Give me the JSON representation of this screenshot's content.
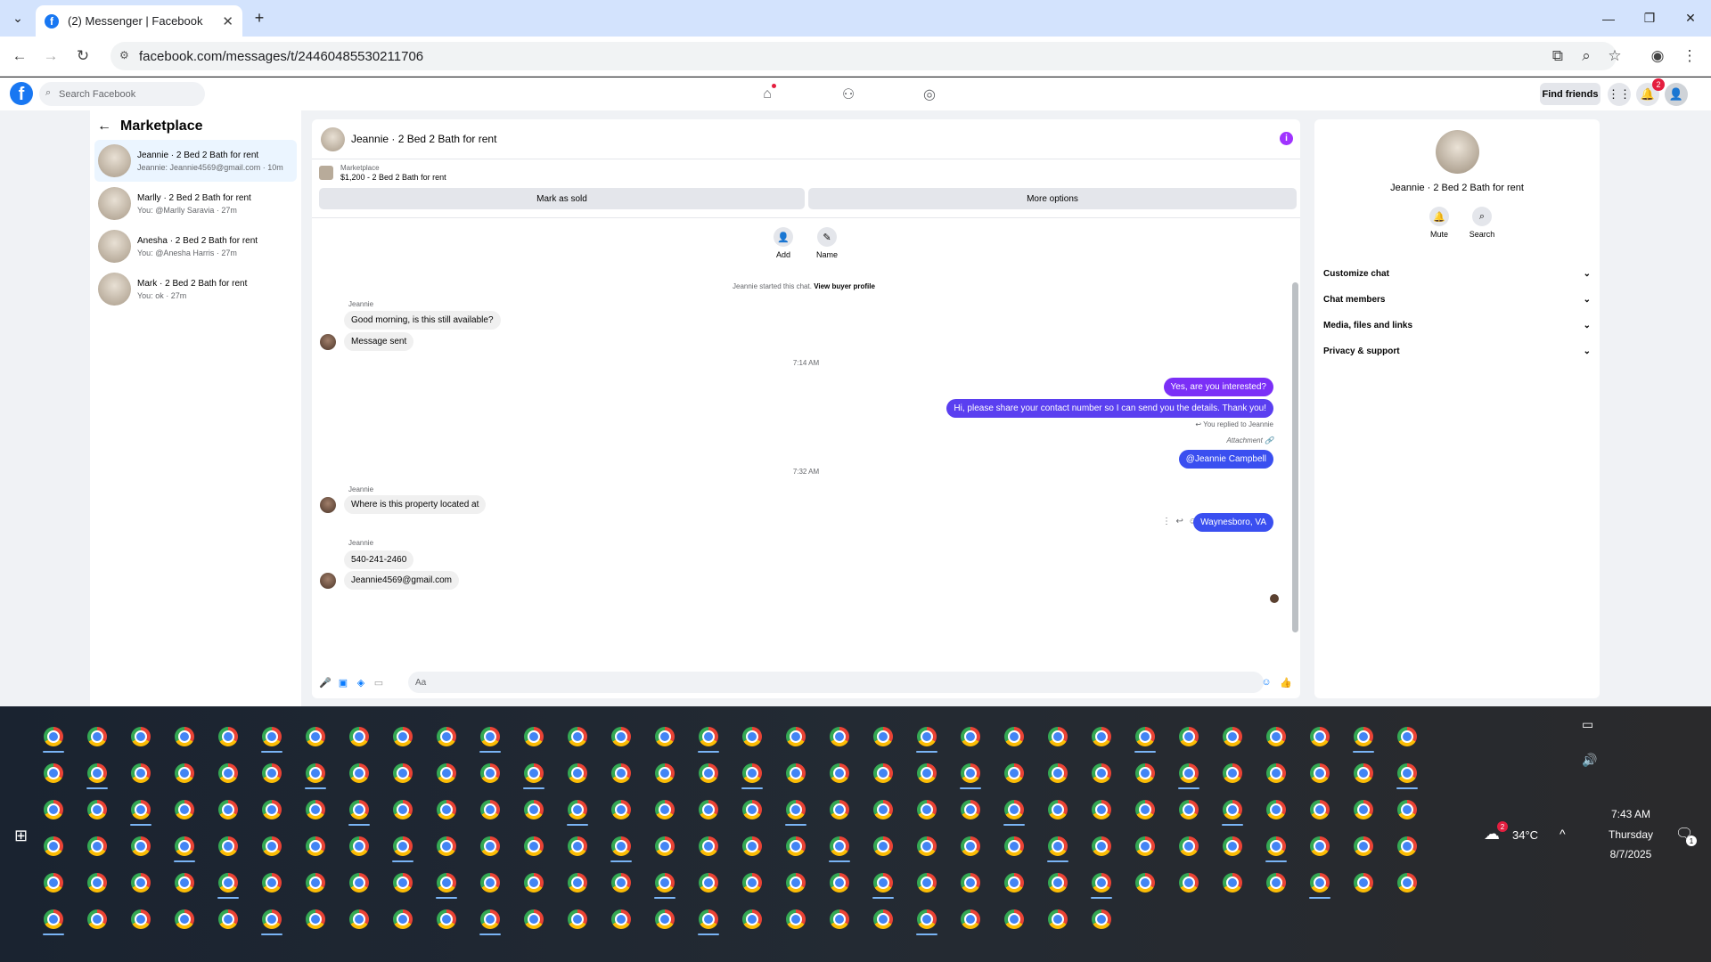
{
  "browser": {
    "tab_title": "(2) Messenger | Facebook",
    "favicon_letter": "f",
    "url": "facebook.com/messages/t/24460485530211706"
  },
  "fb": {
    "logo_letter": "f",
    "search_placeholder": "Search Facebook",
    "find_friends": "Find friends",
    "notif_count": "2"
  },
  "left": {
    "title": "Marketplace",
    "conversations": [
      {
        "title": "Jeannie · 2 Bed 2 Bath for rent",
        "sub": "Jeannie: Jeannie4569@gmail.com · 10m"
      },
      {
        "title": "Marlly · 2 Bed 2 Bath for rent",
        "sub": "You: @Marlly Saravia · 27m"
      },
      {
        "title": "Anesha · 2 Bed 2 Bath for rent",
        "sub": "You: @Anesha Harris · 27m"
      },
      {
        "title": "Mark · 2 Bed 2 Bath for rent",
        "sub": "You: ok · 27m"
      }
    ]
  },
  "chat": {
    "title": "Jeannie · 2 Bed 2 Bath for rent",
    "listing_label": "Marketplace",
    "listing_text": "$1,200 - 2 Bed 2 Bath for rent",
    "mark_sold": "Mark as sold",
    "more_options": "More options",
    "add_label": "Add",
    "name_label": "Name",
    "started_text": "Jeannie started this chat.",
    "view_buyer": "View buyer profile",
    "sender": "Jeannie",
    "msg1": "Good morning, is this still available?",
    "msg2": "Message sent",
    "time1": "7:14 AM",
    "out1": "Yes, are you interested?",
    "out2": "Hi, please share your contact number so I can send you the details. Thank you!",
    "reply_note": "You replied to Jeannie",
    "attachment": "Attachment",
    "mention": "@Jeannie Campbell",
    "time2": "7:32 AM",
    "msg3": "Where is this property located at",
    "out3": "Waynesboro, VA",
    "msg4": "540-241-2460",
    "msg5": "Jeannie4569@gmail.com",
    "composer_placeholder": "Aa"
  },
  "right": {
    "name": "Jeannie · 2 Bed 2 Bath for rent",
    "mute": "Mute",
    "search": "Search",
    "rows": [
      "Customize chat",
      "Chat members",
      "Media, files and links",
      "Privacy & support"
    ]
  },
  "taskbar": {
    "temp": "34°C",
    "weather_badge": "2",
    "time": "7:43 AM",
    "day": "Thursday",
    "date": "8/7/2025",
    "notif_count": "1"
  },
  "colors": {
    "fb_blue": "#1877f2",
    "out_purple": "#7b2ff7",
    "out_blue": "#3a4ff0",
    "chrome_tabbar": "#d3e3fd"
  }
}
